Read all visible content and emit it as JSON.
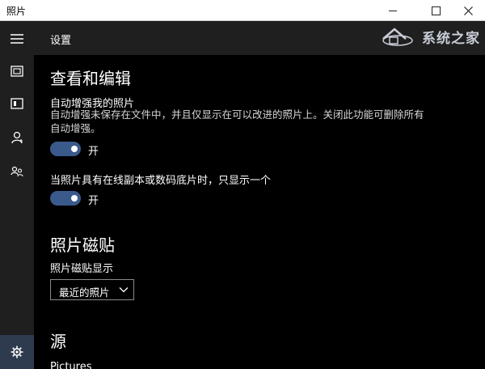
{
  "window": {
    "app_title": "照片"
  },
  "header": {
    "title": "设置",
    "watermark_text": "系统之家"
  },
  "sidebar": {
    "items": [
      {
        "icon": "hamburger-menu-icon"
      },
      {
        "icon": "collection-icon"
      },
      {
        "icon": "album-icon"
      },
      {
        "icon": "people-icon"
      },
      {
        "icon": "shared-icon"
      },
      {
        "icon": "gear-icon",
        "active": true
      }
    ]
  },
  "settings": {
    "view_edit_title": "查看和编辑",
    "auto_enhance": {
      "label": "自动增强我的照片",
      "description": "自动增强未保存在文件中，并且仅显示在可以改进的照片上。关闭此功能可删除所有自动增强。",
      "state": "开",
      "on": true
    },
    "duplicates": {
      "label": "当照片具有在线副本或数码底片时，只显示一个",
      "state": "开",
      "on": true
    },
    "tile_title": "照片磁贴",
    "tile_display": {
      "label": "照片磁贴显示",
      "selected": "最近的照片"
    },
    "sources_title": "源",
    "sources_first_item": "Pictures"
  },
  "colors": {
    "accent": "#3a5a8c",
    "sidebar_bg": "#1f1f1f",
    "content_bg": "#000000"
  }
}
